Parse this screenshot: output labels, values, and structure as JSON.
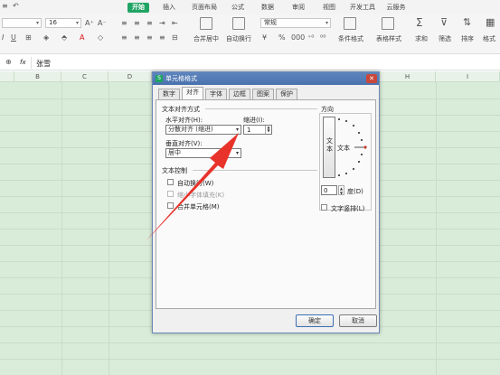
{
  "ribbon": {
    "tabs": [
      "开始",
      "插入",
      "页面布局",
      "公式",
      "数据",
      "审阅",
      "视图",
      "开发工具",
      "云服务"
    ],
    "font_size": "16",
    "buttons": {
      "merge": "合并居中",
      "wrap": "自动换行",
      "number_format": "常规",
      "cond_format": "条件格式",
      "table_style": "表格样式",
      "sum": "求和",
      "filter": "筛选",
      "sort": "排序",
      "format": "格式"
    }
  },
  "formula_bar": {
    "fx": "fx",
    "value": "张雪"
  },
  "columns": [
    "B",
    "C",
    "D",
    "H",
    "I"
  ],
  "dialog": {
    "title": "单元格格式",
    "tabs": [
      "数字",
      "对齐",
      "字体",
      "边框",
      "图案",
      "保护"
    ],
    "section_alignment": "文本对齐方式",
    "h_align_label": "水平对齐(H):",
    "h_align_value": "分散对齐 (缩进)",
    "indent_label": "缩进(I):",
    "indent_value": "1",
    "v_align_label": "垂直对齐(V):",
    "v_align_value": "居中",
    "section_control": "文本控制",
    "wrap_label": "自动换行(W)",
    "shrink_label": "缩小字体填充(K)",
    "merge_label": "合并单元格(M)",
    "orientation_label": "方向",
    "vertical_text": "文本",
    "orient_text": "文本",
    "degree_value": "0",
    "degree_label": "度(D)",
    "vertical_check": "文字竖排(L)",
    "ok": "确定",
    "cancel": "取消"
  },
  "colors": {
    "accent": "#1fa463",
    "arrow": "#e8332b",
    "grid_bg": "#d9ecd9"
  }
}
